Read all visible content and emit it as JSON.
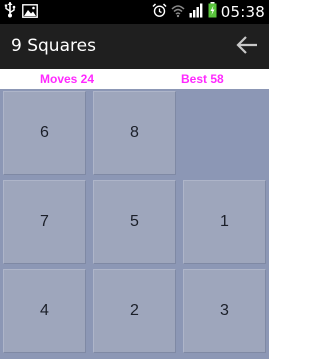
{
  "status_bar": {
    "time": "05:38",
    "left_icons": [
      "usb-icon",
      "image-icon"
    ],
    "right_icons": [
      "alarm-icon",
      "wifi-icon",
      "signal-icon",
      "battery-icon"
    ]
  },
  "app_bar": {
    "title": "9 Squares",
    "back_icon": "arrow-left-icon"
  },
  "score": {
    "moves": "Moves 24",
    "best": "Best 58"
  },
  "board": {
    "rows": [
      [
        "6",
        "8",
        ""
      ],
      [
        "7",
        "5",
        "1"
      ],
      [
        "4",
        "2",
        "3"
      ]
    ]
  },
  "colors": {
    "score_text": "#ff29ff",
    "board_bg": "#8c97b5",
    "tile_bg": "#9ea6bc"
  }
}
